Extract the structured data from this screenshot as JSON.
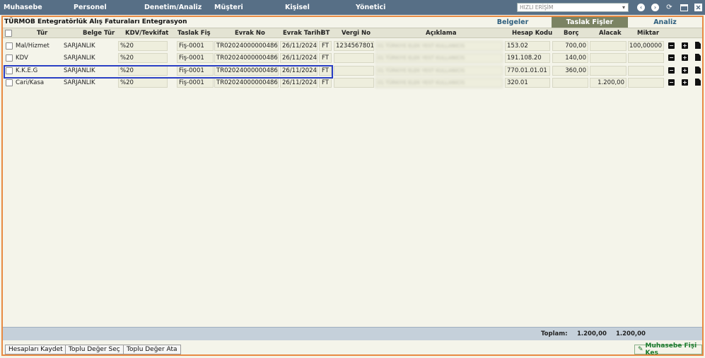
{
  "nav": {
    "menus": [
      "Muhasebe",
      "Personel",
      "Denetim/Analiz",
      "Müşteri",
      "Kişisel",
      "Yönetici"
    ],
    "quick_access_placeholder": "HIZLI ERİŞİM"
  },
  "page": {
    "title": "TÜRMOB Entegratörlük Alış Faturaları Entegrasyon",
    "tabs": [
      "Belgeler",
      "Taslak Fişler",
      "Analiz"
    ],
    "active_tab": "Taslak Fişler"
  },
  "grid": {
    "headers": {
      "tur": "Tür",
      "belge_tur": "Belge Tür",
      "kdv": "KDV/Tevkifat",
      "taslak_fis": "Taslak Fiş",
      "evrak_no": "Evrak No",
      "evrak_tarihi": "Evrak Tarihi",
      "bt": "BT",
      "vergi_no": "Vergi No",
      "aciklama": "Açıklama",
      "hesap_kodu": "Hesap Kodu",
      "borc": "Borç",
      "alacak": "Alacak",
      "miktar": "Miktar"
    },
    "rows": [
      {
        "tur": "Mal/Hizmet",
        "belge_tur": "SARJANLIK",
        "kdv": "%20",
        "taslak_fis": "Fiş-0001",
        "evrak_no": "TR02024000000486",
        "evrak_tarihi": "26/11/2024",
        "bt": "FT",
        "vergi_no": "1234567801",
        "aciklama": "01 TÜRKIYE ELEK YEST KULLANICIS",
        "hesap_kodu": "153.02",
        "borc": "700,00",
        "alacak": "",
        "miktar": "100,00000"
      },
      {
        "tur": "KDV",
        "belge_tur": "SARJANLIK",
        "kdv": "%20",
        "taslak_fis": "Fiş-0001",
        "evrak_no": "TR02024000000486",
        "evrak_tarihi": "26/11/2024",
        "bt": "FT",
        "vergi_no": "",
        "aciklama": "01 TÜRKIYE ELEK YEST KULLANICIS",
        "hesap_kodu": "191.108.20",
        "borc": "140,00",
        "alacak": "",
        "miktar": ""
      },
      {
        "tur": "K.K.E.G",
        "belge_tur": "SARJANLIK",
        "kdv": "%20",
        "taslak_fis": "Fiş-0001",
        "evrak_no": "TR02024000000486",
        "evrak_tarihi": "26/11/2024",
        "bt": "FT",
        "vergi_no": "",
        "aciklama": "01 TÜRKIYE ELEK YEST KULLANICIS",
        "hesap_kodu": "770.01.01.01",
        "borc": "360,00",
        "alacak": "",
        "miktar": ""
      },
      {
        "tur": "Cari/Kasa",
        "belge_tur": "SARJANLIK",
        "kdv": "%20",
        "taslak_fis": "Fiş-0001",
        "evrak_no": "TR02024000000486",
        "evrak_tarihi": "26/11/2024",
        "bt": "FT",
        "vergi_no": "",
        "aciklama": "01 TÜRKIYE ELEK YEST KULLANICIS",
        "hesap_kodu": "320.01",
        "borc": "",
        "alacak": "1.200,00",
        "miktar": ""
      }
    ]
  },
  "totals": {
    "label": "Toplam:",
    "borc": "1.200,00",
    "alacak": "1.200,00"
  },
  "footer": {
    "buttons": [
      "Hesapları Kaydet",
      "Toplu Değer Seç",
      "Toplu Değer Ata"
    ],
    "primary_button": "Muhasebe Fişi Kes"
  },
  "icons": {
    "back": "chevron-left-icon",
    "forward": "chevron-right-icon",
    "refresh": "refresh-icon",
    "window": "window-icon",
    "close": "close-icon",
    "remove": "minus-icon",
    "add": "plus-icon",
    "doc": "document-icon",
    "primary": "edit-icon"
  },
  "colors": {
    "nav_bg": "#576f86",
    "active_tab_bg": "#7b8363",
    "frame_border": "#e88a43",
    "selection": "#2a3fc4",
    "primary_text": "#1a7a2c"
  }
}
